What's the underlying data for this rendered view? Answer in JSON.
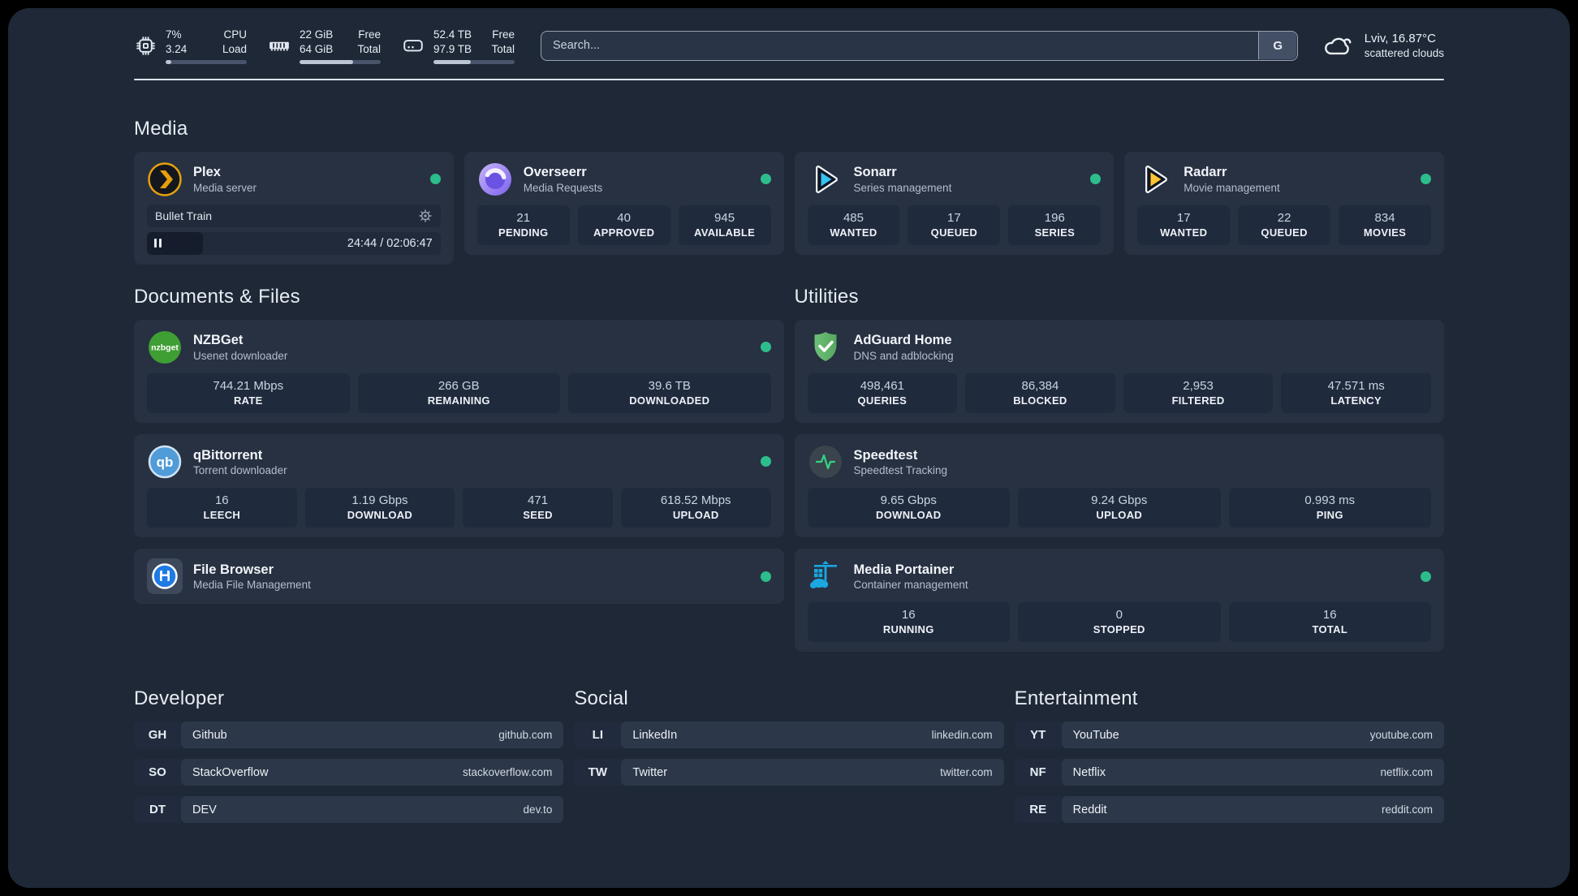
{
  "colors": {
    "status_online": "#2dbd8c",
    "plex_accent": "#e5a00d",
    "sonarr_accent": "#36c3f2",
    "radarr_accent": "#fec433",
    "portainer_accent": "#1ba7e0",
    "speedtest_accent": "#32d583"
  },
  "header": {
    "stats": [
      {
        "icon": "cpu-icon",
        "value_top": "7%",
        "value_bottom": "3.24",
        "label_top": "CPU",
        "label_bottom": "Load",
        "progress_pct": 7
      },
      {
        "icon": "memory-icon",
        "value_top": "22 GiB",
        "value_bottom": "64 GiB",
        "label_top": "Free",
        "label_bottom": "Total",
        "progress_pct": 66
      },
      {
        "icon": "disk-icon",
        "value_top": "52.4 TB",
        "value_bottom": "97.9 TB",
        "label_top": "Free",
        "label_bottom": "Total",
        "progress_pct": 46
      }
    ],
    "search": {
      "placeholder": "Search...",
      "button_label": "G"
    },
    "weather": {
      "location_temp": "Lviv, 16.87°C",
      "condition": "scattered clouds"
    }
  },
  "sections": {
    "media": {
      "title": "Media",
      "apps": [
        {
          "name": "Plex",
          "subtitle": "Media server",
          "online": true,
          "player": {
            "title": "Bullet Train",
            "time": "24:44 / 02:06:47",
            "progress_pct": 19
          }
        },
        {
          "name": "Overseerr",
          "subtitle": "Media Requests",
          "online": true,
          "stats": [
            {
              "value": "21",
              "label": "PENDING"
            },
            {
              "value": "40",
              "label": "APPROVED"
            },
            {
              "value": "945",
              "label": "AVAILABLE"
            }
          ]
        },
        {
          "name": "Sonarr",
          "subtitle": "Series management",
          "online": true,
          "stats": [
            {
              "value": "485",
              "label": "WANTED"
            },
            {
              "value": "17",
              "label": "QUEUED"
            },
            {
              "value": "196",
              "label": "SERIES"
            }
          ]
        },
        {
          "name": "Radarr",
          "subtitle": "Movie management",
          "online": true,
          "stats": [
            {
              "value": "17",
              "label": "WANTED"
            },
            {
              "value": "22",
              "label": "QUEUED"
            },
            {
              "value": "834",
              "label": "MOVIES"
            }
          ]
        }
      ]
    },
    "documents": {
      "title": "Documents & Files",
      "apps": [
        {
          "name": "NZBGet",
          "subtitle": "Usenet downloader",
          "online": true,
          "stats": [
            {
              "value": "744.21 Mbps",
              "label": "RATE"
            },
            {
              "value": "266 GB",
              "label": "REMAINING"
            },
            {
              "value": "39.6 TB",
              "label": "DOWNLOADED"
            }
          ]
        },
        {
          "name": "qBittorrent",
          "subtitle": "Torrent downloader",
          "online": true,
          "stats": [
            {
              "value": "16",
              "label": "LEECH"
            },
            {
              "value": "1.19 Gbps",
              "label": "DOWNLOAD"
            },
            {
              "value": "471",
              "label": "SEED"
            },
            {
              "value": "618.52 Mbps",
              "label": "UPLOAD"
            }
          ]
        },
        {
          "name": "File Browser",
          "subtitle": "Media File Management",
          "online": true
        }
      ]
    },
    "utilities": {
      "title": "Utilities",
      "apps": [
        {
          "name": "AdGuard Home",
          "subtitle": "DNS and adblocking",
          "stats": [
            {
              "value": "498,461",
              "label": "QUERIES"
            },
            {
              "value": "86,384",
              "label": "BLOCKED"
            },
            {
              "value": "2,953",
              "label": "FILTERED"
            },
            {
              "value": "47.571 ms",
              "label": "LATENCY"
            }
          ]
        },
        {
          "name": "Speedtest",
          "subtitle": "Speedtest Tracking",
          "stats": [
            {
              "value": "9.65 Gbps",
              "label": "DOWNLOAD"
            },
            {
              "value": "9.24 Gbps",
              "label": "UPLOAD"
            },
            {
              "value": "0.993 ms",
              "label": "PING"
            }
          ]
        },
        {
          "name": "Media Portainer",
          "subtitle": "Container management",
          "online": true,
          "stats": [
            {
              "value": "16",
              "label": "RUNNING"
            },
            {
              "value": "0",
              "label": "STOPPED"
            },
            {
              "value": "16",
              "label": "TOTAL"
            }
          ]
        }
      ]
    },
    "links": [
      {
        "title": "Developer",
        "items": [
          {
            "abbr": "GH",
            "name": "Github",
            "url": "github.com"
          },
          {
            "abbr": "SO",
            "name": "StackOverflow",
            "url": "stackoverflow.com"
          },
          {
            "abbr": "DT",
            "name": "DEV",
            "url": "dev.to"
          }
        ]
      },
      {
        "title": "Social",
        "items": [
          {
            "abbr": "LI",
            "name": "LinkedIn",
            "url": "linkedin.com"
          },
          {
            "abbr": "TW",
            "name": "Twitter",
            "url": "twitter.com"
          }
        ]
      },
      {
        "title": "Entertainment",
        "items": [
          {
            "abbr": "YT",
            "name": "YouTube",
            "url": "youtube.com"
          },
          {
            "abbr": "NF",
            "name": "Netflix",
            "url": "netflix.com"
          },
          {
            "abbr": "RE",
            "name": "Reddit",
            "url": "reddit.com"
          }
        ]
      }
    ]
  }
}
